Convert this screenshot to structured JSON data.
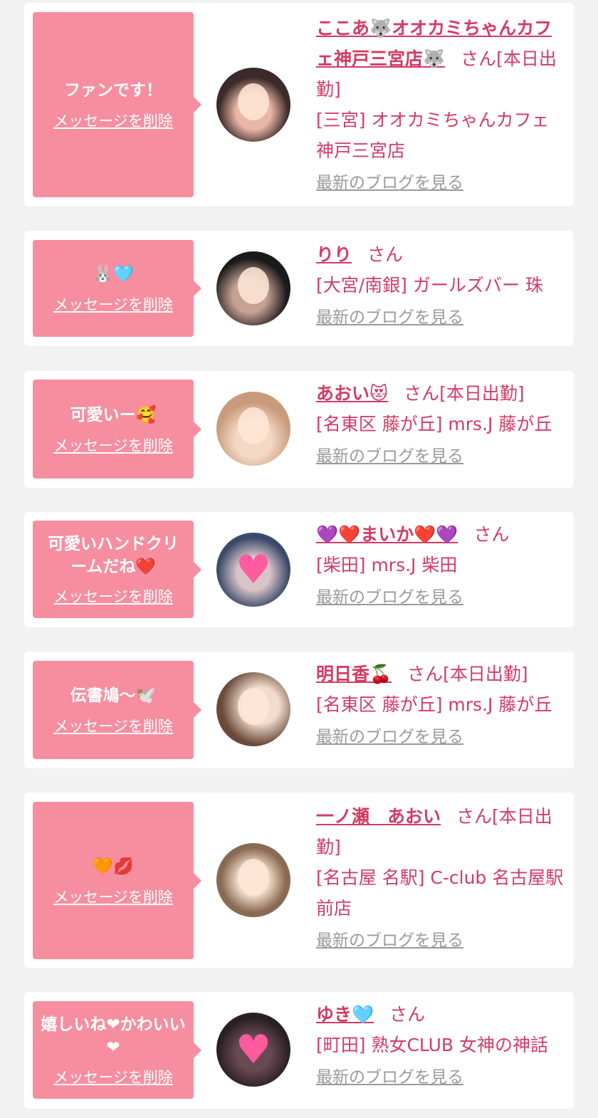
{
  "items": [
    {
      "message": "ファンです！",
      "delete_label": "メッセージを削除",
      "name": "ここあ🐺オオカミちゃんカフェ神戸三宮店🐺",
      "suffix": "さん[本日出勤]",
      "shop": "[三宮] オオカミちゃんカフェ神戸三宮店",
      "blog_label": "最新のブログを見る",
      "avatar_colors": [
        "#3c2a2a",
        "#e9b7a6"
      ]
    },
    {
      "message": "🐰🩵",
      "delete_label": "メッセージを削除",
      "name": "りり",
      "suffix": "さん",
      "shop": "[大宮/南銀] ガールズバー 珠",
      "blog_label": "最新のブログを見る",
      "avatar_colors": [
        "#1a1a1a",
        "#8a6e62"
      ]
    },
    {
      "message": "可愛いー🥰",
      "delete_label": "メッセージを削除",
      "name": "あおい😻",
      "suffix": "さん[本日出勤]",
      "shop": "[名東区 藤が丘] mrs.J 藤が丘",
      "blog_label": "最新のブログを見る",
      "avatar_colors": [
        "#c99a7c",
        "#f3d8c4"
      ]
    },
    {
      "message": "可愛いハンドクリームだね❤️",
      "delete_label": "メッセージを削除",
      "name": "💜❤️まいか❤️💜",
      "suffix": "さん",
      "shop": "[柴田] mrs.J 柴田",
      "blog_label": "最新のブログを見る",
      "avatar_colors": [
        "#3b4a6a",
        "#d9c4c8"
      ]
    },
    {
      "message": "伝書鳩〜🕊️",
      "delete_label": "メッセージを削除",
      "name": "明日香🍒",
      "suffix": "さん[本日出勤]",
      "shop": "[名東区 藤が丘] mrs.J 藤が丘",
      "blog_label": "最新のブログを見る",
      "avatar_colors": [
        "#6b4a3a",
        "#f1dccd"
      ]
    },
    {
      "message": "🧡💋",
      "delete_label": "メッセージを削除",
      "name": "一ノ瀬　あおい",
      "suffix": "さん[本日出勤]",
      "shop": "[名古屋 名駅] C-club 名古屋駅前店",
      "blog_label": "最新のブログを見る",
      "avatar_colors": [
        "#8a6a52",
        "#f0d9c6"
      ]
    },
    {
      "message": "嬉しいね❤かわいい❤",
      "delete_label": "メッセージを削除",
      "name": "ゆき🩵",
      "suffix": "さん",
      "shop": "[町田] 熟女CLUB 女神の神話",
      "blog_label": "最新のブログを見る",
      "avatar_colors": [
        "#2a1f24",
        "#6a4a52"
      ]
    }
  ]
}
